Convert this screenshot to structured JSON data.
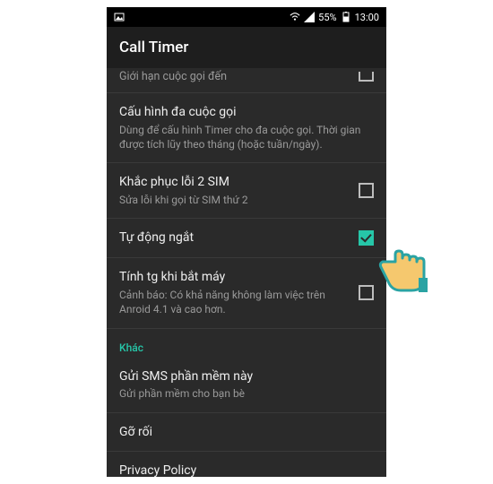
{
  "statusbar": {
    "battery_text": "55%",
    "time": "13:00"
  },
  "appbar": {
    "title": "Call Timer"
  },
  "rows": {
    "incoming_limit_sub": "Giới hạn cuộc gọi đến",
    "multi_title": "Cấu hình đa cuộc gọi",
    "multi_sub": "Dùng để cấu hình Timer cho đa cuộc gọi. Thời gian được tích lũy theo tháng (hoặc tuần/ngày).",
    "sim2_title": "Khắc phục lỗi 2 SIM",
    "sim2_sub": "Sửa lỗi khi gọi từ SIM thứ 2",
    "auto_title": "Tự động ngắt",
    "answer_title": "Tính tg khi bắt máy",
    "answer_sub": "Cảnh báo: Có khả năng không làm việc trên Anroid 4.1 và cao hơn.",
    "section_other": "Khác",
    "sms_title": "Gửi SMS phần mềm này",
    "sms_sub": "Gửi phần mềm cho bạn bè",
    "debug_title": "Gỡ rối",
    "privacy_title": "Privacy Policy"
  }
}
